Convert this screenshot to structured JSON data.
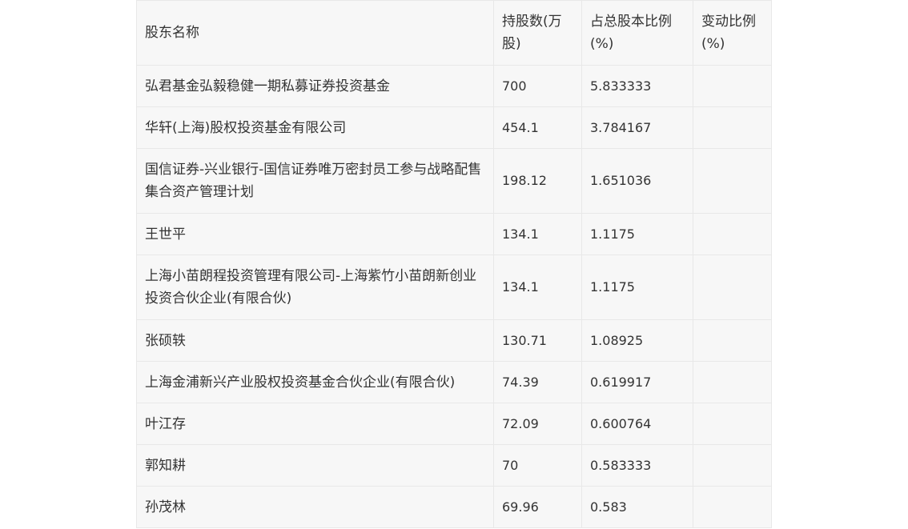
{
  "table": {
    "headers": [
      "股东名称",
      "持股数(万股)",
      "占总股本比例(%)",
      "变动比例(%)"
    ],
    "rows": [
      {
        "name": "弘君基金弘毅稳健一期私募证券投资基金",
        "shares": "700",
        "ratio": "5.833333",
        "change": ""
      },
      {
        "name": "华轩(上海)股权投资基金有限公司",
        "shares": "454.1",
        "ratio": "3.784167",
        "change": ""
      },
      {
        "name": "国信证券-兴业银行-国信证券唯万密封员工参与战略配售集合资产管理计划",
        "shares": "198.12",
        "ratio": "1.651036",
        "change": ""
      },
      {
        "name": "王世平",
        "shares": "134.1",
        "ratio": "1.1175",
        "change": ""
      },
      {
        "name": "上海小苗朗程投资管理有限公司-上海紫竹小苗朗新创业投资合伙企业(有限合伙)",
        "shares": "134.1",
        "ratio": "1.1175",
        "change": ""
      },
      {
        "name": "张硕轶",
        "shares": "130.71",
        "ratio": "1.08925",
        "change": ""
      },
      {
        "name": "上海金浦新兴产业股权投资基金合伙企业(有限合伙)",
        "shares": "74.39",
        "ratio": "0.619917",
        "change": ""
      },
      {
        "name": "叶江存",
        "shares": "72.09",
        "ratio": "0.600764",
        "change": ""
      },
      {
        "name": "郭知耕",
        "shares": "70",
        "ratio": "0.583333",
        "change": ""
      },
      {
        "name": "孙茂林",
        "shares": "69.96",
        "ratio": "0.583",
        "change": ""
      }
    ]
  }
}
